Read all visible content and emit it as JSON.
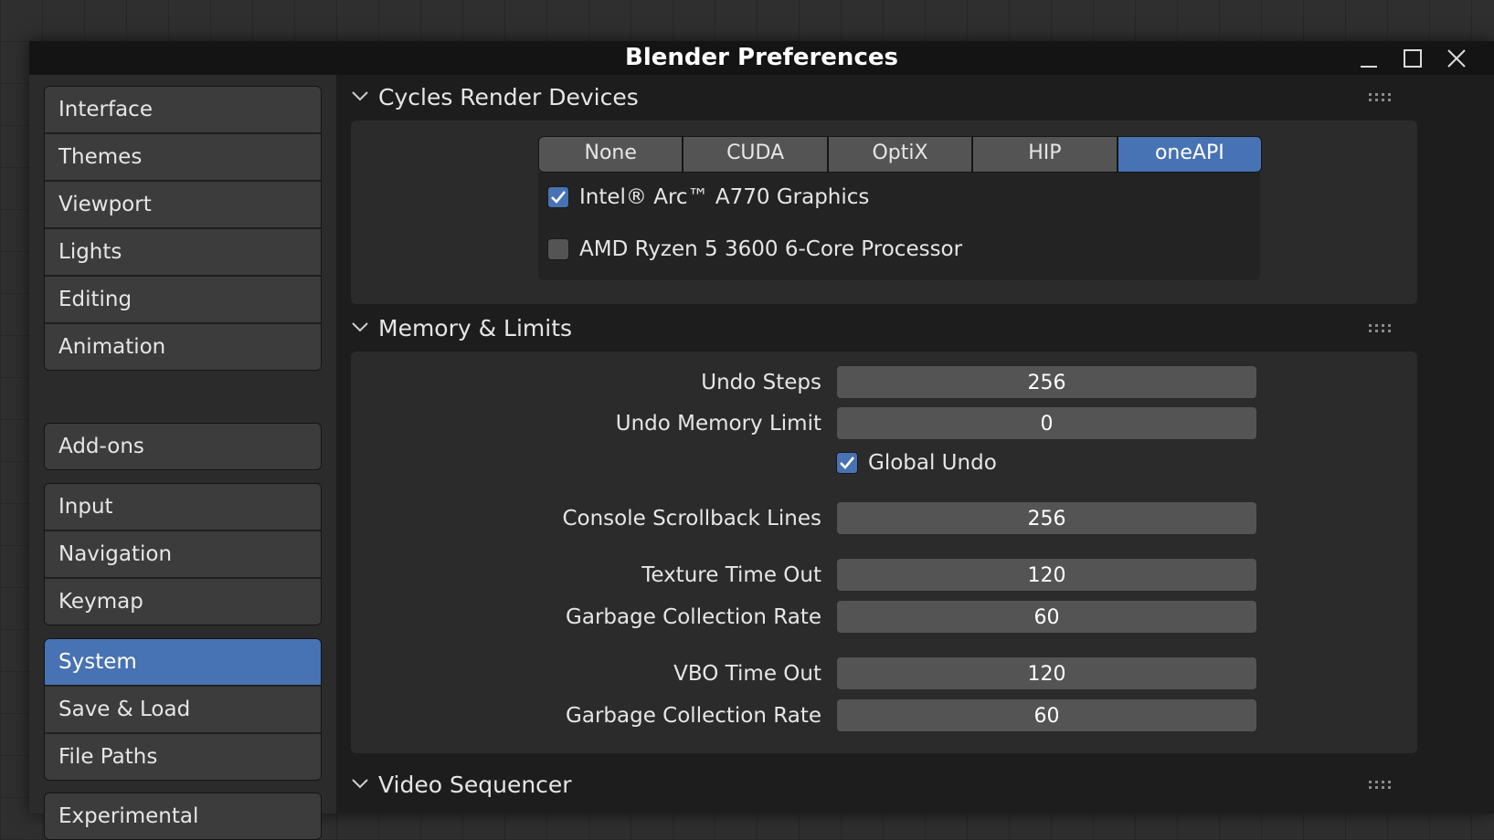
{
  "window": {
    "title": "Blender Preferences"
  },
  "sidebar": {
    "groups": [
      {
        "items": [
          {
            "label": "Interface"
          },
          {
            "label": "Themes"
          },
          {
            "label": "Viewport"
          },
          {
            "label": "Lights"
          },
          {
            "label": "Editing"
          },
          {
            "label": "Animation"
          }
        ]
      },
      {
        "items": [
          {
            "label": "Add-ons"
          }
        ]
      },
      {
        "items": [
          {
            "label": "Input"
          },
          {
            "label": "Navigation"
          },
          {
            "label": "Keymap"
          }
        ]
      },
      {
        "items": [
          {
            "label": "System",
            "active": true
          },
          {
            "label": "Save & Load"
          },
          {
            "label": "File Paths"
          }
        ]
      },
      {
        "items": [
          {
            "label": "Experimental"
          }
        ]
      }
    ]
  },
  "panels": {
    "cycles": {
      "title": "Cycles Render Devices",
      "backends": [
        "None",
        "CUDA",
        "OptiX",
        "HIP",
        "oneAPI"
      ],
      "selected_backend": "oneAPI",
      "devices": [
        {
          "label": "Intel® Arc™ A770 Graphics",
          "checked": true
        },
        {
          "label": "AMD Ryzen 5 3600 6-Core Processor",
          "checked": false
        }
      ]
    },
    "memory": {
      "title": "Memory & Limits",
      "undo_steps": {
        "label": "Undo Steps",
        "value": "256"
      },
      "undo_memory_limit": {
        "label": "Undo Memory Limit",
        "value": "0"
      },
      "global_undo": {
        "label": "Global Undo",
        "checked": true
      },
      "console_scrollback": {
        "label": "Console Scrollback Lines",
        "value": "256"
      },
      "texture_time_out": {
        "label": "Texture Time Out",
        "value": "120"
      },
      "texture_gc_rate": {
        "label": "Garbage Collection Rate",
        "value": "60"
      },
      "vbo_time_out": {
        "label": "VBO Time Out",
        "value": "120"
      },
      "vbo_gc_rate": {
        "label": "Garbage Collection Rate",
        "value": "60"
      }
    },
    "video_sequencer": {
      "title": "Video Sequencer"
    }
  },
  "colors": {
    "accent": "#4772b3",
    "field": "#545454",
    "panel": "#2b2b2b",
    "background": "#1d1d1d"
  },
  "icons": [
    "minimize-icon",
    "maximize-icon",
    "close-icon",
    "chevron-down-icon",
    "drag-grip-icon",
    "checkmark-icon"
  ]
}
